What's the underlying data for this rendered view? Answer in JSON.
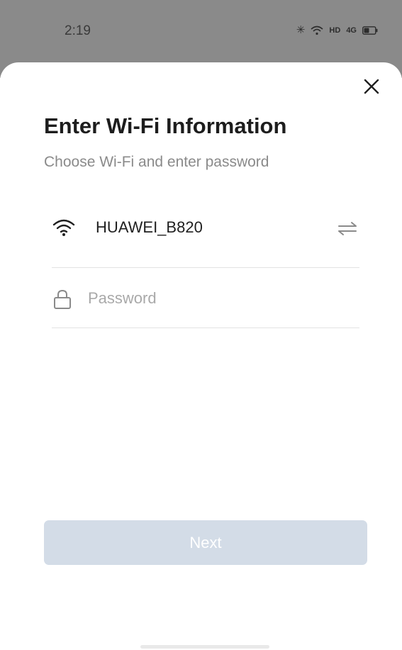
{
  "status_bar": {
    "time": "2:19",
    "network_label": "HD",
    "signal_label": "4G",
    "icons": [
      "bluetooth-icon",
      "wifi-icon",
      "hd-icon",
      "signal-icon",
      "battery-icon"
    ]
  },
  "sheet": {
    "title": "Enter Wi-Fi Information",
    "subtitle": "Choose Wi-Fi and enter password",
    "close_icon": "close-icon"
  },
  "wifi": {
    "network_name": "HUAWEI_B820",
    "icon": "wifi-icon",
    "switch_icon": "switch-network-icon"
  },
  "password": {
    "placeholder": "Password",
    "value": "",
    "icon": "lock-icon"
  },
  "actions": {
    "next_label": "Next"
  },
  "colors": {
    "status_bar_bg": "#8a8a8a",
    "next_button_bg": "#d3dce7",
    "subtitle_text": "#8a8a8a",
    "placeholder_text": "#a9a9a9",
    "divider": "#e3e3e3"
  }
}
